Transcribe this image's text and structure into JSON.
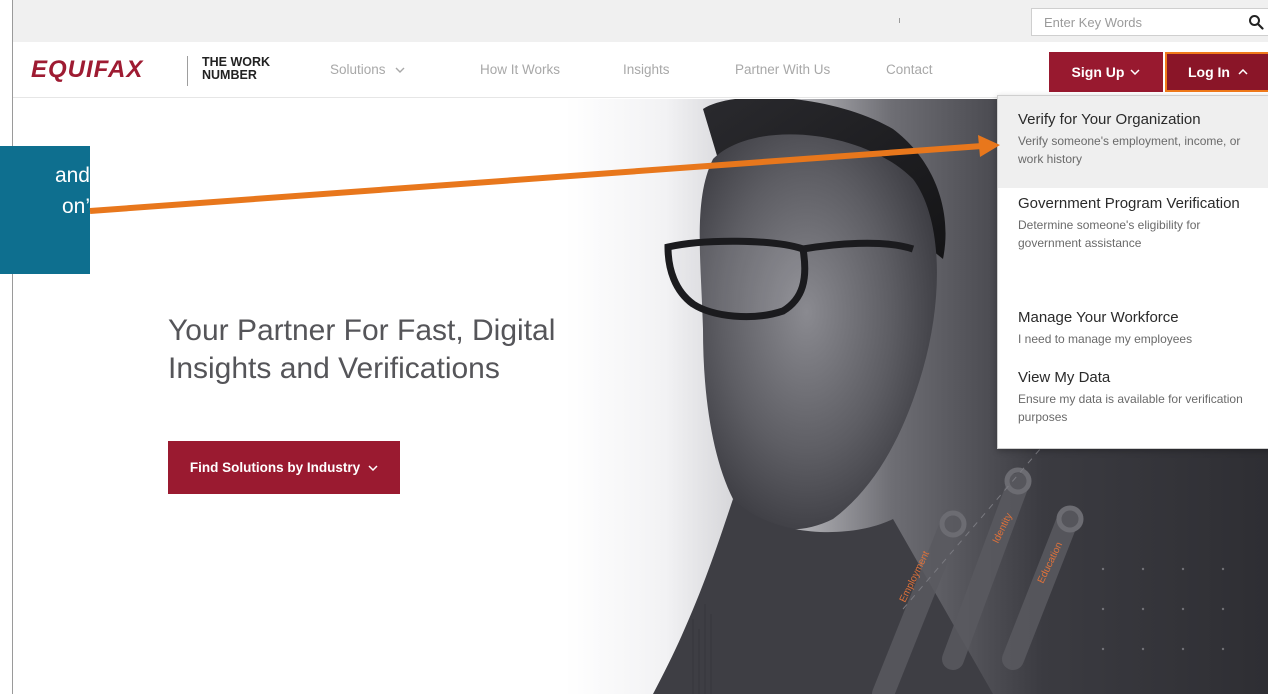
{
  "search": {
    "placeholder": "Enter Key Words"
  },
  "logo": {
    "brand": "EQUIFAX",
    "product_line1": "THE WORK",
    "product_line2": "NUMBER"
  },
  "nav": {
    "items": [
      {
        "label": "Solutions"
      },
      {
        "label": "How It Works"
      },
      {
        "label": "Insights"
      },
      {
        "label": "Partner With Us"
      },
      {
        "label": "Contact"
      }
    ],
    "signup_label": "Sign Up",
    "login_label": "Log In"
  },
  "hero": {
    "title_line1": "Your Partner For Fast, Digital",
    "title_line2": "Insights and Verifications",
    "cta_label": "Find Solutions by Industry",
    "badges": [
      "Employment",
      "Identity",
      "Education"
    ]
  },
  "dropdown": {
    "items": [
      {
        "title": "Verify for Your Organization",
        "desc": "Verify someone's employment, income, or work history"
      },
      {
        "title": "Government Program Verification",
        "desc": "Determine someone's eligibility for government assistance"
      },
      {
        "title": "Manage Your Workforce",
        "desc": "I need to manage my employees"
      },
      {
        "title": "View My Data",
        "desc": "Ensure my data is available for verification purposes"
      }
    ]
  },
  "callout": {
    "line1": "and",
    "line2": "on’"
  },
  "colors": {
    "brand_red": "#9a1a30",
    "accent_orange": "#e8771c",
    "callout_blue": "#0e6f8f"
  }
}
